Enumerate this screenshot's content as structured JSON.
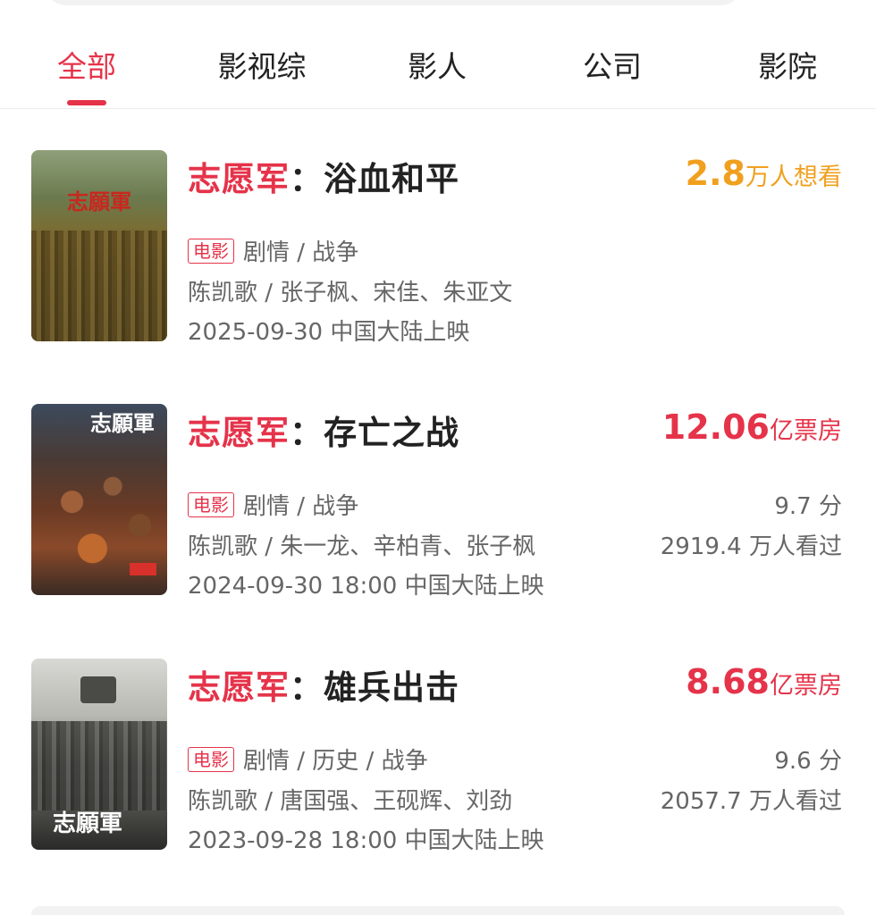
{
  "tabs": [
    {
      "label": "全部",
      "active": true
    },
    {
      "label": "影视综",
      "active": false
    },
    {
      "label": "影人",
      "active": false
    },
    {
      "label": "公司",
      "active": false
    },
    {
      "label": "影院",
      "active": false
    }
  ],
  "colors": {
    "accent": "#e5334a",
    "want_orange": "#f0a01e"
  },
  "movies": [
    {
      "title_prefix": "志愿军",
      "title_rest": "：浴血和平",
      "metric_num": "2.8",
      "metric_unit": "万人想看",
      "tag": "电影",
      "genre": "剧情 / 战争",
      "cast": "陈凯歌 / 张子枫、宋佳、朱亚文",
      "release": "2025-09-30 中国大陆上映",
      "score": "",
      "viewers": "",
      "poster_title": "志願軍"
    },
    {
      "title_prefix": "志愿军",
      "title_rest": "：存亡之战",
      "metric_num": "12.06",
      "metric_unit": "亿票房",
      "tag": "电影",
      "genre": "剧情 / 战争",
      "cast": "陈凯歌 / 朱一龙、辛柏青、张子枫",
      "release": "2024-09-30 18:00 中国大陆上映",
      "score": "9.7 分",
      "viewers": "2919.4 万人看过",
      "poster_title": "志願軍"
    },
    {
      "title_prefix": "志愿军",
      "title_rest": "：雄兵出击",
      "metric_num": "8.68",
      "metric_unit": "亿票房",
      "tag": "电影",
      "genre": "剧情 / 历史 / 战争",
      "cast": "陈凯歌 / 唐国强、王砚辉、刘劲",
      "release": "2023-09-28 18:00 中国大陆上映",
      "score": "9.6 分",
      "viewers": "2057.7 万人看过",
      "poster_title": "志願軍"
    }
  ]
}
